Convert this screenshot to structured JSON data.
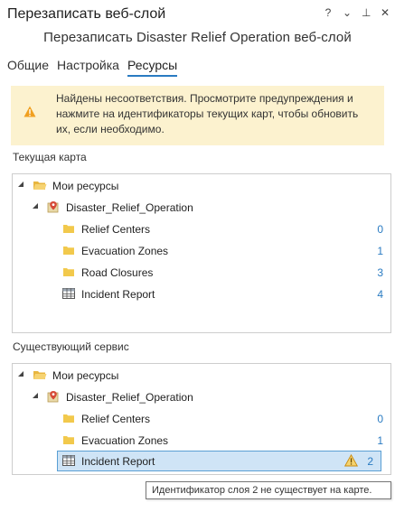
{
  "window": {
    "pane_title": "Перезаписать веб-слой",
    "subtitle": "Перезаписать Disaster Relief Operation веб-слой",
    "buttons": {
      "help": "?",
      "menu": "⌄",
      "pin": "⊥",
      "close": "✕"
    }
  },
  "tabs": [
    {
      "label": "Общие",
      "active": false
    },
    {
      "label": "Настройка",
      "active": false
    },
    {
      "label": "Ресурсы",
      "active": true
    }
  ],
  "warning": {
    "text": "Найдены несоответствия. Просмотрите предупреждения и нажмите на идентификаторы текущих карт, чтобы обновить их, если необходимо.",
    "icon": "warning-icon",
    "color": "#fcf2cf"
  },
  "current_map": {
    "label": "Текущая карта",
    "root": "Мои ресурсы",
    "map": "Disaster_Relief_Operation",
    "items": [
      {
        "name": "Relief Centers",
        "id": "0",
        "icon": "layer-icon"
      },
      {
        "name": "Evacuation Zones",
        "id": "1",
        "icon": "layer-icon"
      },
      {
        "name": "Road Closures",
        "id": "3",
        "icon": "layer-icon"
      },
      {
        "name": "Incident Report",
        "id": "4",
        "icon": "table-icon"
      }
    ]
  },
  "existing_service": {
    "label": "Существующий сервис",
    "root": "Мои ресурсы",
    "map": "Disaster_Relief_Operation",
    "items": [
      {
        "name": "Relief Centers",
        "id": "0",
        "icon": "layer-icon"
      },
      {
        "name": "Evacuation Zones",
        "id": "1",
        "icon": "layer-icon"
      },
      {
        "name": "Incident Report",
        "id": "2",
        "icon": "table-icon",
        "selected": true,
        "warning": true
      }
    ]
  },
  "tooltip": {
    "text": "Идентификатор слоя 2 не существует на карте."
  },
  "colors": {
    "accent": "#2a7bc2",
    "folder": "#f2c94c",
    "warn": "#f0a020",
    "selection": "#cfe4f6"
  }
}
